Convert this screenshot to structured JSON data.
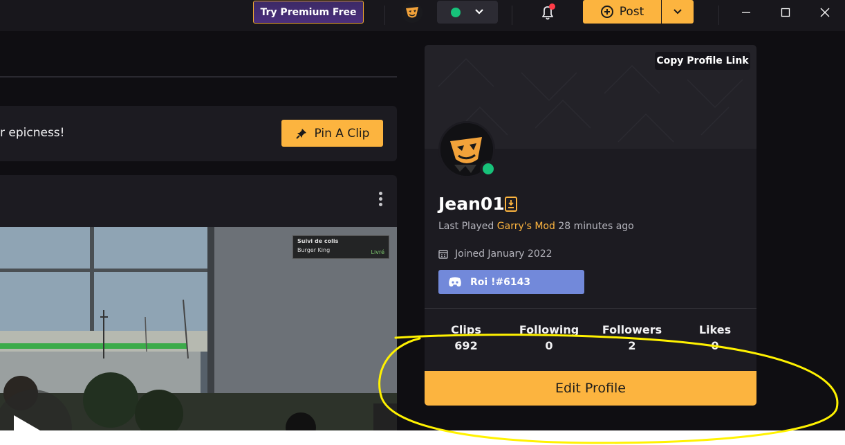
{
  "titlebar": {
    "premium_label": "Try Premium Free",
    "status_color": "#17c27a",
    "post_label": "Post",
    "icons": [
      "user-avatar-icon",
      "chevron-down-icon",
      "bell-icon",
      "plus-circle-icon",
      "minimize-icon",
      "maximize-icon",
      "close-icon"
    ]
  },
  "main": {
    "pin_prompt": "r epicness!",
    "pin_button": "Pin A Clip",
    "video_overlay": {
      "title": "Suivi de colis",
      "item": "Burger King",
      "status": "Livré"
    }
  },
  "profile": {
    "copy_link": "Copy Profile Link",
    "username": "Jean01",
    "last_played_prefix": "Last Played ",
    "last_played_game": "Garry's Mod",
    "last_played_suffix": " 28 minutes ago",
    "joined": "Joined January 2022",
    "discord_tag": "Roi !#6143",
    "stats": [
      {
        "label": "Clips",
        "value": "692"
      },
      {
        "label": "Following",
        "value": "0"
      },
      {
        "label": "Followers",
        "value": "2"
      },
      {
        "label": "Likes",
        "value": "0"
      }
    ],
    "edit_button": "Edit Profile"
  },
  "colors": {
    "accent": "#fcb43f",
    "discord": "#7289da",
    "online": "#17c27a",
    "annotation": "#fff200"
  }
}
